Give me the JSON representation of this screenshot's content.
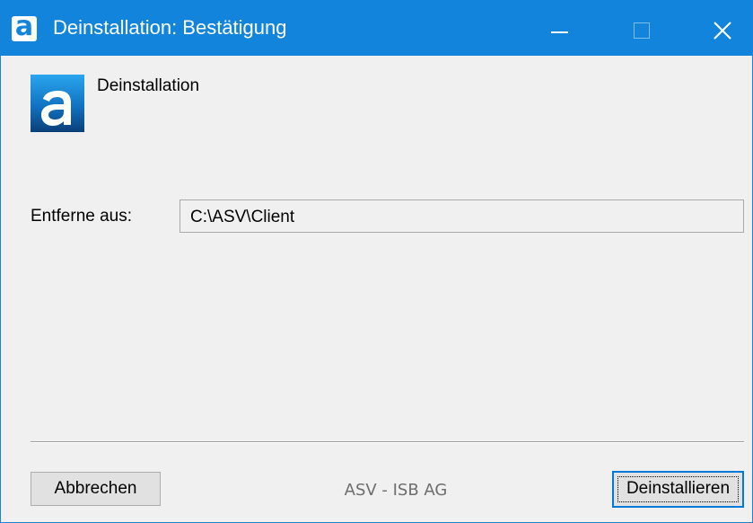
{
  "window": {
    "title": "Deinstallation: Bestätigung",
    "app_icon_glyph": "a",
    "controls": {
      "minimize_icon": "minimize-icon",
      "maximize_icon": "maximize-icon",
      "close_icon": "close-icon"
    },
    "accent_color": "#1284db"
  },
  "content": {
    "logo_icon": "asv-logo-icon",
    "heading": "Deinstallation",
    "remove_from": {
      "label": "Entferne aus:",
      "value": "C:\\ASV\\Client"
    }
  },
  "footer": {
    "cancel_label": "Abbrechen",
    "vendor_text": "ASV - ISB AG",
    "uninstall_label": "Deinstallieren"
  }
}
